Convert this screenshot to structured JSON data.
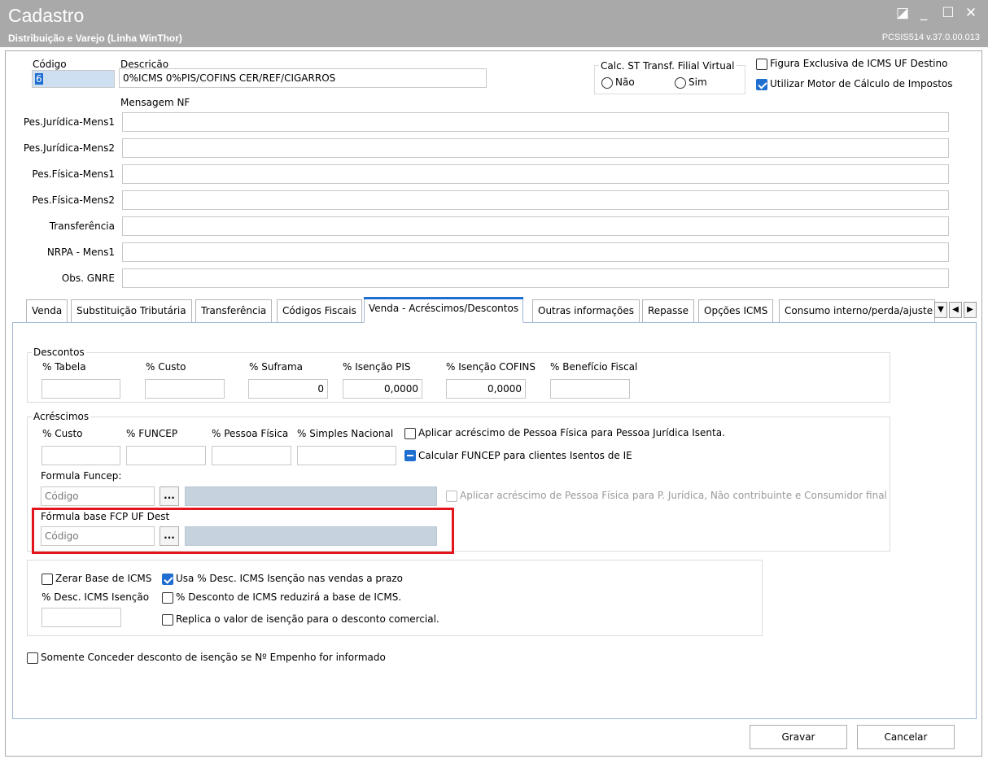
{
  "window": {
    "title": "Cadastro",
    "subtitle": "Distribuição e Varejo (Linha WinThor)",
    "version": "PCSIS514  v.37.0.00.013",
    "controls": {
      "restore": "◪",
      "minimize": "_",
      "maximize": "☐",
      "close": "✕"
    }
  },
  "header": {
    "codigo_label": "Código",
    "codigo_value": "6",
    "descricao_label": "Descrição",
    "descricao_value": "0%ICMS 0%PIS/COFINS  CER/REF/CIGARROS",
    "calc_st_label": "Calc. ST Transf. Filial Virtual",
    "calc_st_options": [
      "Não",
      "Sim"
    ],
    "figura_exclusiva_label": "Figura Exclusiva de ICMS UF Destino",
    "figura_exclusiva_checked": false,
    "motor_calculo_label": "Utilizar Motor de Cálculo de Impostos",
    "motor_calculo_checked": true,
    "mensagem_nf_label": "Mensagem NF"
  },
  "messages": [
    {
      "label": "Pes.Jurídica-Mens1",
      "value": ""
    },
    {
      "label": "Pes.Jurídica-Mens2",
      "value": ""
    },
    {
      "label": "Pes.Física-Mens1",
      "value": ""
    },
    {
      "label": "Pes.Física-Mens2",
      "value": ""
    },
    {
      "label": "Transferência",
      "value": ""
    },
    {
      "label": "NRPA - Mens1",
      "value": ""
    },
    {
      "label": "Obs. GNRE",
      "value": ""
    }
  ],
  "tabs": [
    {
      "label": "Venda"
    },
    {
      "label": "Substituição Tributária"
    },
    {
      "label": "Transferência"
    },
    {
      "label": "Códigos Fiscais"
    },
    {
      "label": "Venda - Acréscimos/Descontos",
      "active": true
    },
    {
      "label": "Outras informações"
    },
    {
      "label": "Repasse"
    },
    {
      "label": "Opções ICMS"
    },
    {
      "label": "Consumo interno/perda/ajuste"
    }
  ],
  "descontos": {
    "title": "Descontos",
    "fields": [
      {
        "label": "% Tabela",
        "value": ""
      },
      {
        "label": "% Custo",
        "value": ""
      },
      {
        "label": "% Suframa",
        "value": "0"
      },
      {
        "label": "% Isenção PIS",
        "value": "0,0000"
      },
      {
        "label": "% Isenção COFINS",
        "value": "0,0000"
      },
      {
        "label": "% Benefício Fiscal",
        "value": ""
      }
    ]
  },
  "acrescimos": {
    "title": "Acréscimos",
    "fields": [
      {
        "label": "% Custo",
        "value": ""
      },
      {
        "label": "% FUNCEP",
        "value": ""
      },
      {
        "label": "% Pessoa Física",
        "value": ""
      },
      {
        "label": "% Simples Nacional",
        "value": ""
      }
    ],
    "aplicar_pf_pj_label": "Aplicar acréscimo de Pessoa Física para Pessoa Jurídica Isenta.",
    "calcular_funcep_label": "Calcular FUNCEP para clientes Isentos de IE",
    "formula_funcep_label": "Formula Funcep:",
    "formula_funcep_placeholder": "Código",
    "aplicar_nao_contrib_label": "Aplicar acréscimo de Pessoa Física para P. Jurídica, Não contribuinte e Consumidor final",
    "formula_fcp_label": "Fórmula base FCP UF Dest",
    "formula_fcp_placeholder": "Código",
    "dots_label": "..."
  },
  "icms": {
    "zerar_base_label": "Zerar Base de ICMS",
    "usa_desc_label": "Usa % Desc. ICMS Isenção nas vendas a prazo",
    "desc_icms_isencao_label": "% Desc. ICMS Isenção",
    "desc_reduzira_label": "% Desconto de ICMS reduzirá a base de ICMS.",
    "replica_label": "Replica o valor de isenção para o desconto comercial.",
    "somente_conceder_label": "Somente Conceder desconto de isenção se Nº Empenho for informado"
  },
  "footer": {
    "gravar_label": "Gravar",
    "cancelar_label": "Cancelar"
  },
  "colors": {
    "accent": "#1f6fd0",
    "highlight": "#e3141b",
    "titlebar": "#a9a9a9"
  }
}
